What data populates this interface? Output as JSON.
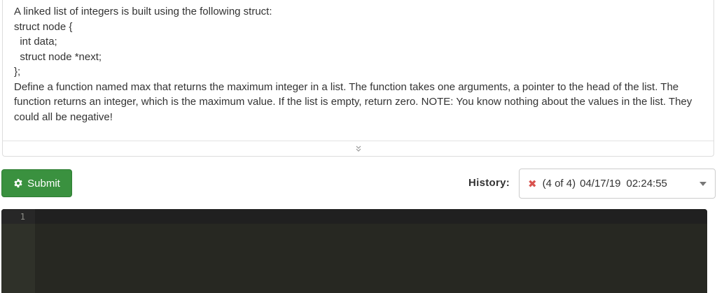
{
  "problem": {
    "lines": [
      "A linked list of integers is built using the following struct:",
      "struct node {",
      "  int data;",
      "  struct node *next;",
      "};"
    ],
    "description": "Define a function named max that returns the maximum integer in a list. The function takes one arguments, a pointer to the head of the list. The function returns an integer, which is the maximum value. If the list is empty, return zero. NOTE: You know nothing about the values in the list. They could all be negative!",
    "expand_icon": "double-chevron-down-icon"
  },
  "toolbar": {
    "submit_label": "Submit",
    "submit_icon": "gear-icon",
    "submit_color": "#3a913f",
    "history_label": "History:",
    "history": {
      "status_icon": "x-icon",
      "status_symbol": "✖",
      "count": "(4 of 4)",
      "date": "04/17/19",
      "time": "02:24:55"
    }
  },
  "editor": {
    "line_numbers": [
      "1"
    ],
    "background": "#272822"
  }
}
